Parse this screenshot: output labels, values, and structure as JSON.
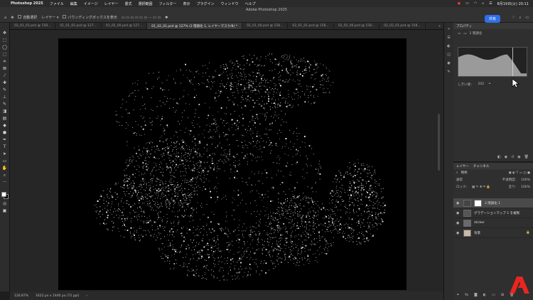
{
  "menubar": {
    "app": "Photoshop 2025",
    "items": [
      "ファイル",
      "編集",
      "イメージ",
      "レイヤー",
      "書式",
      "選択範囲",
      "フィルター",
      "表示",
      "プラグイン",
      "ウィンドウ",
      "ヘルプ"
    ],
    "date_time": "8月19日(火) 20:11"
  },
  "window_title": "Adobe Photoshop 2025",
  "options": {
    "auto_select": "自動選択",
    "layer": "レイヤー",
    "bbox": "バウンディングボックスを表示",
    "share": "共有"
  },
  "tabs": [
    "02_01_01.psd @ 158...",
    "01_01_01.psd @ 127...",
    "01_02_00.psd @ 127...",
    "01_02_01.psd @ 127% (2 階調化 1, レイヤーマスク/8) *",
    "02_01_00.psd @ 158...",
    "02_01_01.psd @ 158...",
    "02_02_00.psd @ 158...",
    "02_02_01.psd @ 158..."
  ],
  "status": {
    "zoom": "126.87%",
    "doc_size": "1622 px x 1440 px (72 ppi)"
  },
  "properties": {
    "tab": "プロパティ",
    "adjustment": "2 階調化",
    "level_label": "しきい値：",
    "level_value": "202"
  },
  "layers_panel": {
    "tabs": [
      "レイヤー",
      "チャンネル"
    ],
    "filter": "種類",
    "blend": "通常",
    "opacity_label": "不透明度：",
    "opacity": "100%",
    "lock_label": "ロック：",
    "fill_label": "塗り：",
    "fill": "100%",
    "layers": [
      {
        "name": "2 階調化 1",
        "selected": true
      },
      {
        "name": "グラデーションマップ 1 を複製",
        "selected": false
      },
      {
        "name": "sticker",
        "selected": false
      },
      {
        "name": "背景",
        "selected": false
      }
    ]
  },
  "colors": {
    "accent": "#2f6fea",
    "adobe_red": "#e8261f"
  }
}
